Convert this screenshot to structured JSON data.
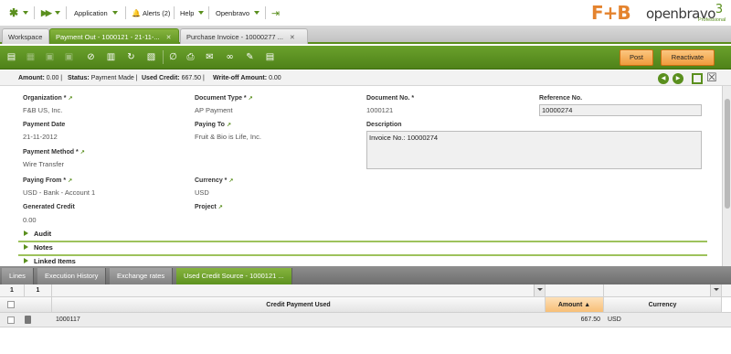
{
  "topnav": {
    "application": "Application",
    "alerts": "Alerts (2)",
    "help": "Help",
    "user": "Openbravo"
  },
  "branding": {
    "fb_logo": "F+B",
    "ob_logo": "openbravo",
    "ob_sup": "3",
    "ob_edition": "Professional"
  },
  "window_tabs": [
    {
      "label": "Workspace"
    },
    {
      "label": "Payment Out - 1000121 - 21-11-..."
    },
    {
      "label": "Purchase Invoice - 10000277 ..."
    }
  ],
  "toolbar": {
    "post": "Post",
    "reactivate": "Reactivate"
  },
  "status": {
    "amount_label": "Amount:",
    "amount": "0.00",
    "status_label": "Status:",
    "status": "Payment Made",
    "used_credit_label": "Used Credit:",
    "used_credit": "667.50",
    "writeoff_label": "Write-off Amount:",
    "writeoff": "0.00"
  },
  "form": {
    "organization_label": "Organization *",
    "organization": "F&B US, Inc.",
    "doctype_label": "Document Type *",
    "doctype": "AP Payment",
    "docno_label": "Document No. *",
    "docno": "1000121",
    "refno_label": "Reference No.",
    "refno": "10000274",
    "paydate_label": "Payment Date",
    "paydate": "21-11-2012",
    "payingto_label": "Paying To",
    "payingto": "Fruit & Bio is Life, Inc.",
    "description_label": "Description",
    "description": "Invoice No.: 10000274",
    "paymethod_label": "Payment Method *",
    "paymethod": "Wire Transfer",
    "payingfrom_label": "Paying From *",
    "payingfrom": "USD - Bank - Account 1",
    "currency_label": "Currency *",
    "currency": "USD",
    "gencredit_label": "Generated Credit",
    "gencredit": "0.00",
    "project_label": "Project"
  },
  "sections": [
    "Audit",
    "Notes",
    "Linked Items"
  ],
  "subtabs": [
    {
      "label": "Lines"
    },
    {
      "label": "Execution History"
    },
    {
      "label": "Exchange rates"
    },
    {
      "label": "Used Credit Source - 1000121 ..."
    }
  ],
  "grid": {
    "pager_a": "1",
    "pager_b": "1",
    "columns": [
      "Credit Payment Used",
      "Amount ▲",
      "Currency"
    ],
    "rows": [
      {
        "credit_payment_used": "1000117",
        "amount": "667.50",
        "currency": "USD"
      }
    ]
  },
  "colors": {
    "accent_green": "#5a8f1e",
    "toolbar_green": "#4f8219",
    "action_orange": "#ef9b3c",
    "brand_orange": "#e4832e"
  }
}
